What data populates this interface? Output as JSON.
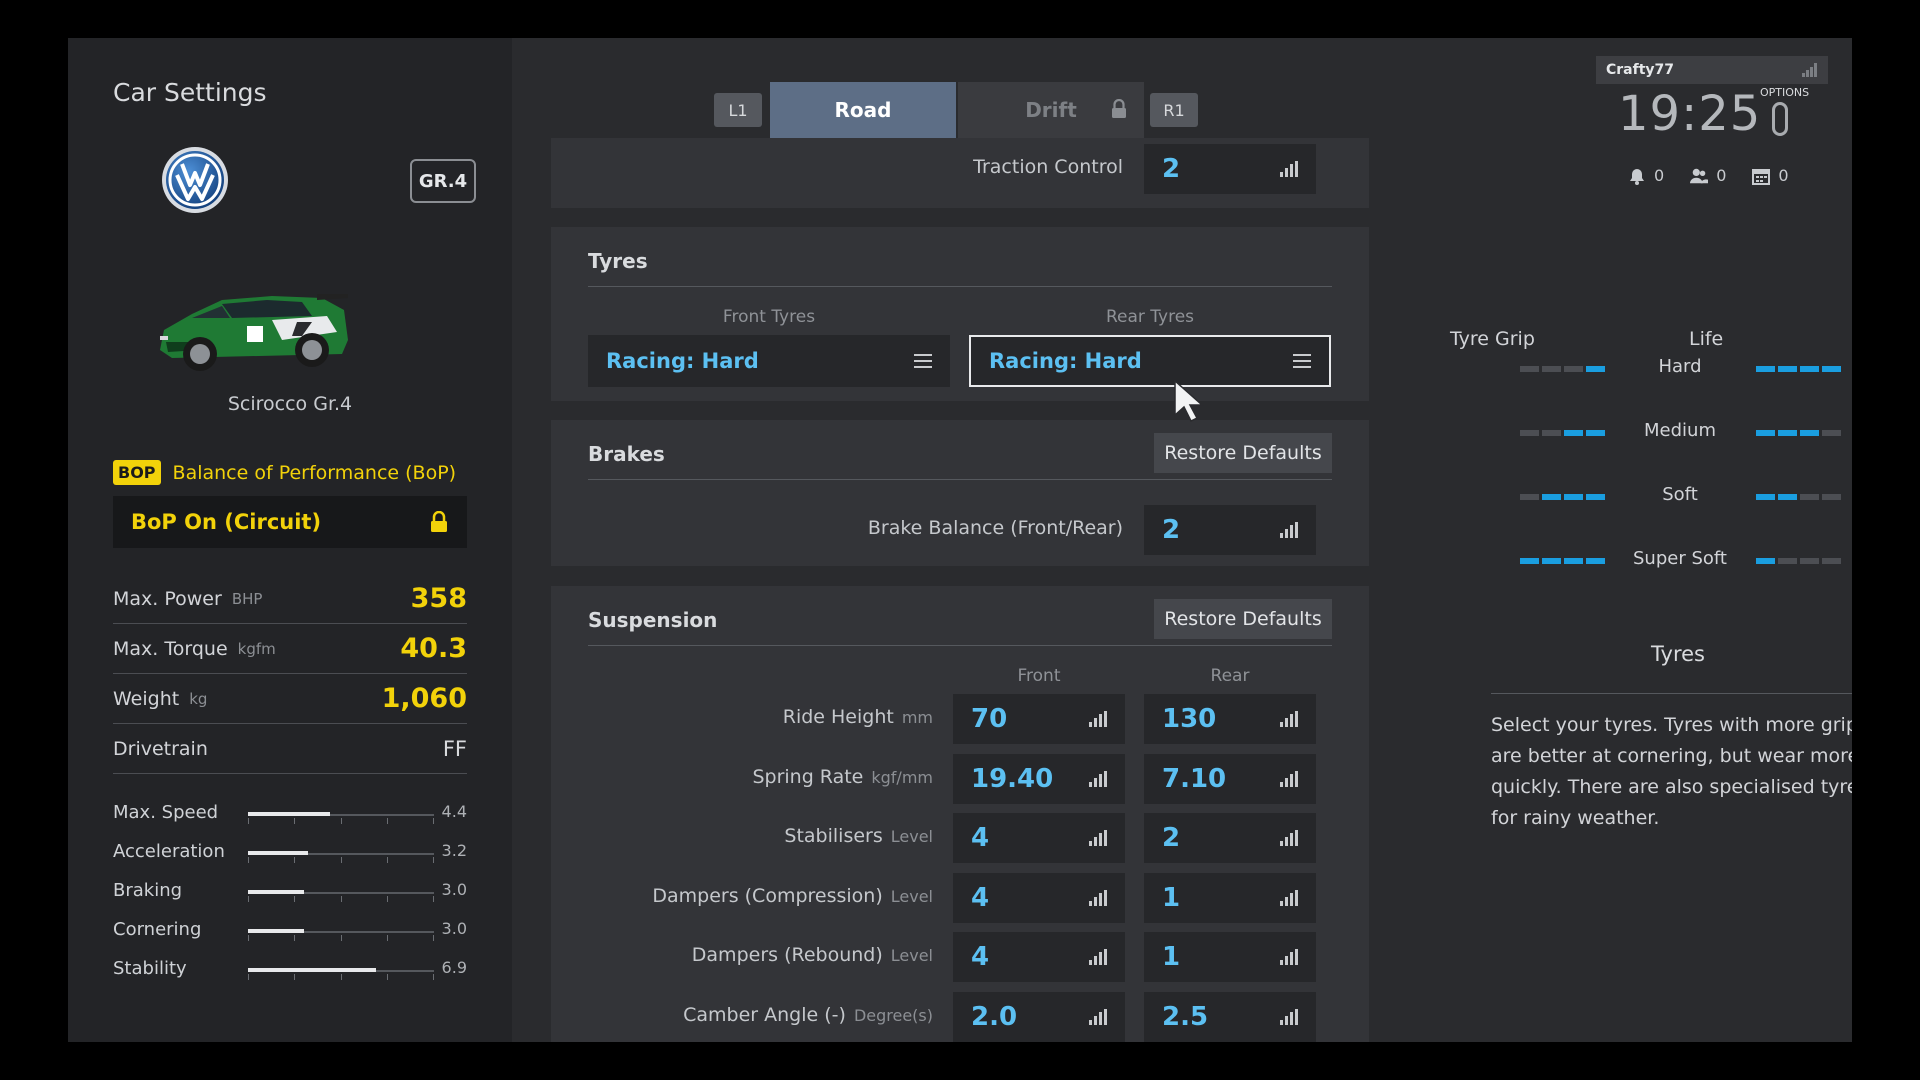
{
  "sidebar": {
    "title": "Car Settings",
    "class_badge": "GR.4",
    "car_name": "Scirocco Gr.4",
    "bop_badge": "BOP",
    "bop_title": "Balance of Performance (BoP)",
    "bop_status": "BoP On (Circuit)",
    "stats": [
      {
        "label": "Max. Power",
        "unit": "BHP",
        "value": "358"
      },
      {
        "label": "Max. Torque",
        "unit": "kgfm",
        "value": "40.3"
      },
      {
        "label": "Weight",
        "unit": "kg",
        "value": "1,060"
      },
      {
        "label": "Drivetrain",
        "unit": "",
        "value": "FF"
      }
    ],
    "performance": [
      {
        "label": "Max. Speed",
        "value": "4.4",
        "level": 0.44
      },
      {
        "label": "Acceleration",
        "value": "3.2",
        "level": 0.32
      },
      {
        "label": "Braking",
        "value": "3.0",
        "level": 0.3
      },
      {
        "label": "Cornering",
        "value": "3.0",
        "level": 0.3
      },
      {
        "label": "Stability",
        "value": "6.9",
        "level": 0.69
      }
    ]
  },
  "tabs": {
    "left_shoulder": "L1",
    "right_shoulder": "R1",
    "items": [
      {
        "label": "Road",
        "active": true
      },
      {
        "label": "Drift",
        "active": false,
        "locked": true
      }
    ]
  },
  "traction": {
    "label": "Traction Control",
    "value": "2"
  },
  "tyres": {
    "title": "Tyres",
    "front_label": "Front Tyres",
    "rear_label": "Rear Tyres",
    "front_value": "Racing: Hard",
    "rear_value": "Racing: Hard"
  },
  "brakes": {
    "title": "Brakes",
    "restore_label": "Restore Defaults",
    "balance_label": "Brake Balance (Front/Rear)",
    "balance_value": "2"
  },
  "suspension": {
    "title": "Suspension",
    "restore_label": "Restore Defaults",
    "front_head": "Front",
    "rear_head": "Rear",
    "rows": [
      {
        "label": "Ride Height",
        "unit": "mm",
        "front": "70",
        "rear": "130"
      },
      {
        "label": "Spring Rate",
        "unit": "kgf/mm",
        "front": "19.40",
        "rear": "7.10"
      },
      {
        "label": "Stabilisers",
        "unit": "Level",
        "front": "4",
        "rear": "2"
      },
      {
        "label": "Dampers (Compression)",
        "unit": "Level",
        "front": "4",
        "rear": "1"
      },
      {
        "label": "Dampers (Rebound)",
        "unit": "Level",
        "front": "4",
        "rear": "1"
      },
      {
        "label": "Camber Angle (-)",
        "unit": "Degree(s)",
        "front": "2.0",
        "rear": "2.5"
      }
    ]
  },
  "system": {
    "username": "Crafty77",
    "time": "19:25",
    "options_label": "OPTIONS",
    "notifications": "0",
    "friends": "0",
    "events": "0"
  },
  "tyre_info": {
    "grip_head": "Tyre Grip",
    "life_head": "Life",
    "rows": [
      {
        "name": "Hard",
        "grip": 1,
        "life": 4
      },
      {
        "name": "Medium",
        "grip": 2,
        "life": 3
      },
      {
        "name": "Soft",
        "grip": 3,
        "life": 2
      },
      {
        "name": "Super Soft",
        "grip": 4,
        "life": 1
      }
    ],
    "help_title": "Tyres",
    "help_text": "Select your tyres. Tyres with more grip are better at cornering, but wear more quickly. There are also specialised tyres for rainy weather."
  },
  "colors": {
    "accent_blue": "#5cc0f2",
    "bop_yellow": "#f2d20a",
    "active_tab": "#5d6e86",
    "pip_on": "#1a9ee0"
  }
}
